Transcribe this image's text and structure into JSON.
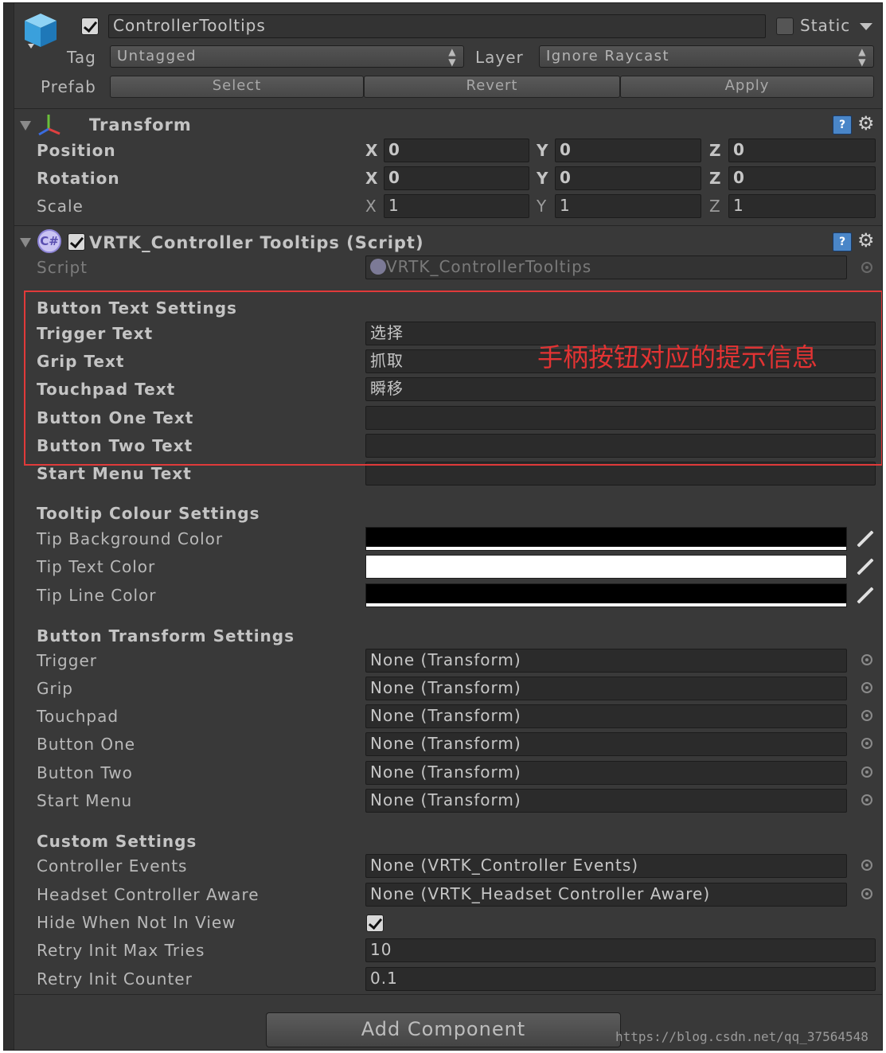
{
  "header": {
    "object_name": "ControllerTooltips",
    "static_label": "Static",
    "tag_label": "Tag",
    "tag_value": "Untagged",
    "layer_label": "Layer",
    "layer_value": "Ignore Raycast",
    "prefab_label": "Prefab",
    "prefab_buttons": [
      "Select",
      "Revert",
      "Apply"
    ]
  },
  "transform": {
    "title": "Transform",
    "rows": [
      {
        "label": "Position",
        "x": "0",
        "y": "0",
        "z": "0"
      },
      {
        "label": "Rotation",
        "x": "0",
        "y": "0",
        "z": "0"
      },
      {
        "label": "Scale",
        "x": "1",
        "y": "1",
        "z": "1"
      }
    ],
    "axes": [
      "X",
      "Y",
      "Z"
    ]
  },
  "script_component": {
    "title": "VRTK_Controller Tooltips (Script)",
    "script_label": "Script",
    "script_value": "VRTK_ControllerTooltips"
  },
  "button_text": {
    "header": "Button Text Settings",
    "rows": [
      {
        "label": "Trigger Text",
        "value": "选择"
      },
      {
        "label": "Grip Text",
        "value": "抓取"
      },
      {
        "label": "Touchpad Text",
        "value": "瞬移"
      },
      {
        "label": "Button One Text",
        "value": ""
      },
      {
        "label": "Button Two Text",
        "value": ""
      },
      {
        "label": "Start Menu Text",
        "value": ""
      }
    ]
  },
  "annotation": "手柄按钮对应的提示信息",
  "colour": {
    "header": "Tooltip Colour Settings",
    "rows": [
      {
        "label": "Tip Background Color",
        "color": "#000000"
      },
      {
        "label": "Tip Text Color",
        "color": "#ffffff"
      },
      {
        "label": "Tip Line Color",
        "color": "#000000"
      }
    ]
  },
  "button_transform": {
    "header": "Button Transform Settings",
    "rows": [
      {
        "label": "Trigger",
        "value": "None (Transform)"
      },
      {
        "label": "Grip",
        "value": "None (Transform)"
      },
      {
        "label": "Touchpad",
        "value": "None (Transform)"
      },
      {
        "label": "Button One",
        "value": "None (Transform)"
      },
      {
        "label": "Button Two",
        "value": "None (Transform)"
      },
      {
        "label": "Start Menu",
        "value": "None (Transform)"
      }
    ]
  },
  "custom": {
    "header": "Custom Settings",
    "controller_events_label": "Controller Events",
    "controller_events_value": "None (VRTK_Controller Events)",
    "headset_aware_label": "Headset Controller Aware",
    "headset_aware_value": "None (VRTK_Headset Controller Aware)",
    "hide_label": "Hide When Not In View",
    "hide_checked": true,
    "retry_max_label": "Retry Init Max Tries",
    "retry_max_value": "10",
    "retry_counter_label": "Retry Init Counter",
    "retry_counter_value": "0.1"
  },
  "add_component_label": "Add Component",
  "watermark": "https://blog.csdn.net/qq_37564548"
}
